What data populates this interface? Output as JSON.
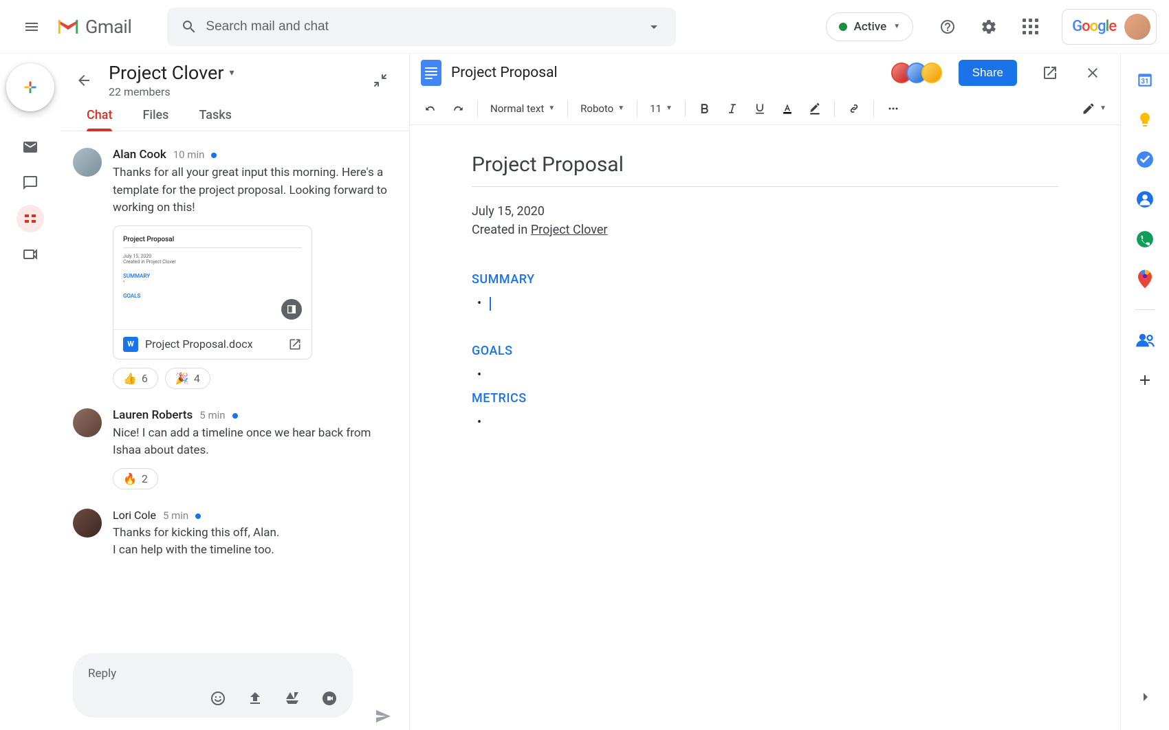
{
  "header": {
    "product": "Gmail",
    "search_placeholder": "Search mail and chat",
    "status_label": "Active"
  },
  "room": {
    "title": "Project Clover",
    "subtitle": "22 members"
  },
  "tabs": {
    "chat": "Chat",
    "files": "Files",
    "tasks": "Tasks"
  },
  "messages": [
    {
      "author": "Alan Cook",
      "time": "10 min",
      "text": "Thanks for all your great input this morning. Here's a template for the project proposal. Looking forward to working on this!",
      "attachment": {
        "preview_title": "Project Proposal",
        "preview_date": "July 15, 2020",
        "preview_created": "Created in Project Clover",
        "preview_sec1": "SUMMARY",
        "preview_sec2": "GOALS",
        "filename": "Project Proposal.docx",
        "doc_letter": "W"
      },
      "reactions": [
        {
          "emoji": "👍",
          "count": "6"
        },
        {
          "emoji": "🎉",
          "count": "4"
        }
      ]
    },
    {
      "author": "Lauren Roberts",
      "time": "5 min",
      "text": "Nice! I can add a timeline once we hear back from Ishaa about dates.",
      "reactions": [
        {
          "emoji": "🔥",
          "count": "2"
        }
      ]
    },
    {
      "author": "Lori Cole",
      "time": "5 min",
      "text": "Thanks for kicking this off, Alan.\nI can help with the timeline too."
    }
  ],
  "reply": {
    "placeholder": "Reply"
  },
  "doc": {
    "title": "Project Proposal",
    "share_label": "Share",
    "toolbar": {
      "style": "Normal text",
      "font": "Roboto",
      "size": "11"
    },
    "body": {
      "h1": "Project Proposal",
      "date": "July 15, 2020",
      "created_prefix": "Created in ",
      "created_link": "Project Clover",
      "sections": {
        "summary": "SUMMARY",
        "goals": "GOALS",
        "metrics": "METRICS"
      }
    }
  }
}
